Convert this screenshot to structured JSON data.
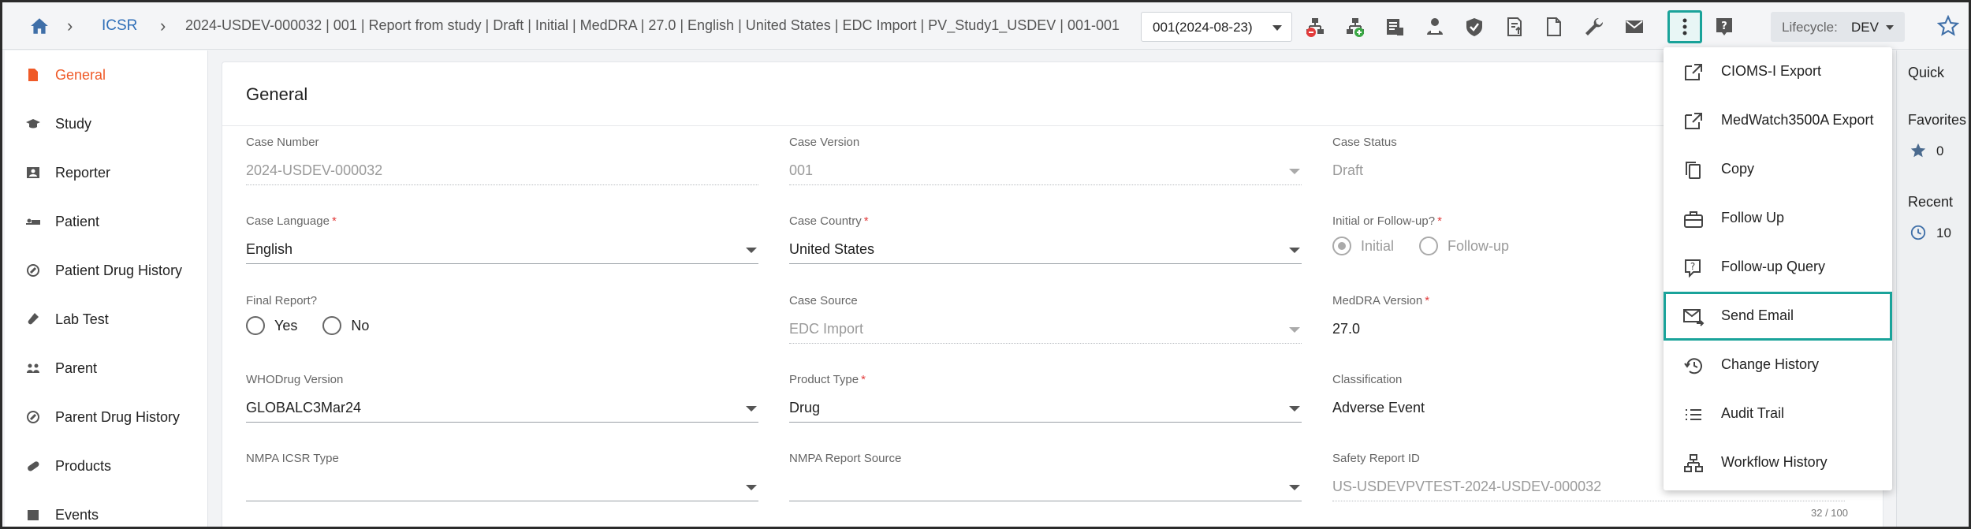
{
  "breadcrumb": {
    "root": "ICSR",
    "case_path": "2024-USDEV-000032 | 001 | Report from study | Draft | Initial | MedDRA | 27.0 | English | United States | EDC Import | PV_Study1_USDEV | 001-001"
  },
  "version_select": {
    "value": "001(2024-08-23)"
  },
  "lifecycle": {
    "label": "Lifecycle:",
    "value": "DEV"
  },
  "sidebar": {
    "items": [
      {
        "label": "General",
        "icon": "document-icon"
      },
      {
        "label": "Study",
        "icon": "graduation-cap-icon"
      },
      {
        "label": "Reporter",
        "icon": "contact-card-icon"
      },
      {
        "label": "Patient",
        "icon": "patient-bed-icon"
      },
      {
        "label": "Patient Drug History",
        "icon": "pill-history-icon"
      },
      {
        "label": "Lab Test",
        "icon": "test-tube-icon"
      },
      {
        "label": "Parent",
        "icon": "family-icon"
      },
      {
        "label": "Parent Drug History",
        "icon": "pill-history-icon"
      },
      {
        "label": "Products",
        "icon": "capsule-icon"
      },
      {
        "label": "Events",
        "icon": "event-icon"
      }
    ]
  },
  "main": {
    "title": "General",
    "fields": {
      "case_number": {
        "label": "Case Number",
        "value": "2024-USDEV-000032"
      },
      "case_version": {
        "label": "Case Version",
        "value": "001"
      },
      "case_status": {
        "label": "Case Status",
        "value": "Draft"
      },
      "case_language": {
        "label": "Case Language",
        "value": "English"
      },
      "case_country": {
        "label": "Case Country",
        "value": "United States"
      },
      "initial_followup": {
        "label": "Initial or Follow-up?",
        "option1": "Initial",
        "option2": "Follow-up"
      },
      "final_report": {
        "label": "Final Report?",
        "option1": "Yes",
        "option2": "No"
      },
      "case_source": {
        "label": "Case Source",
        "value": "EDC Import"
      },
      "meddra_version": {
        "label": "MedDRA Version",
        "value": "27.0"
      },
      "whodrug_version": {
        "label": "WHODrug Version",
        "value": "GLOBALC3Mar24"
      },
      "product_type": {
        "label": "Product Type",
        "value": "Drug"
      },
      "classification": {
        "label": "Classification",
        "value": "Adverse Event"
      },
      "nmpa_icsr_type": {
        "label": "NMPA ICSR Type",
        "value": ""
      },
      "nmpa_report_source": {
        "label": "NMPA Report Source",
        "value": ""
      },
      "safety_report_id": {
        "label": "Safety Report ID",
        "value": "US-USDEVPVTEST-2024-USDEV-000032",
        "counter": "32 / 100"
      }
    },
    "required_mark": "*"
  },
  "right_panel": {
    "quick": "Quick",
    "favorites": "Favorites",
    "favorites_count": "0",
    "recent": "Recent",
    "recent_count": "10"
  },
  "more_menu": {
    "items": [
      {
        "label": "CIOMS-I Export",
        "icon": "external-link-icon"
      },
      {
        "label": "MedWatch3500A Export",
        "icon": "external-link-icon"
      },
      {
        "label": "Copy",
        "icon": "copy-icon"
      },
      {
        "label": "Follow Up",
        "icon": "briefcase-icon"
      },
      {
        "label": "Follow-up Query",
        "icon": "question-box-icon"
      },
      {
        "label": "Send Email",
        "icon": "mail-send-icon",
        "highlighted": true
      },
      {
        "label": "Change History",
        "icon": "history-icon"
      },
      {
        "label": "Audit Trail",
        "icon": "list-icon"
      },
      {
        "label": "Workflow History",
        "icon": "workflow-icon"
      }
    ]
  },
  "colors": {
    "accent": "#ef5a28",
    "highlight": "#1aa39a",
    "link": "#2f6fb8"
  }
}
